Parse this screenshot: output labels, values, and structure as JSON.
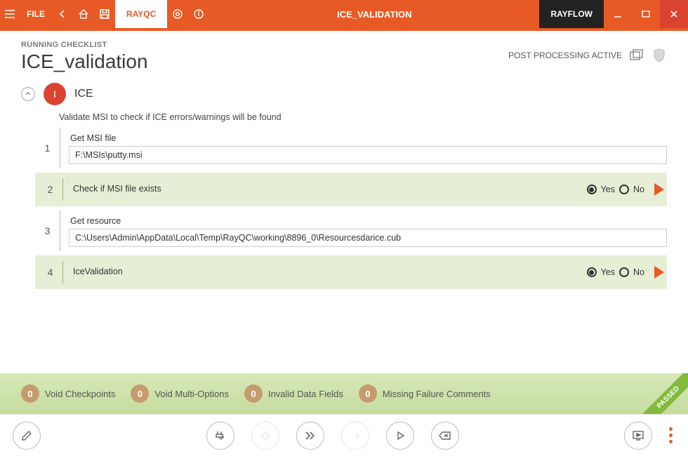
{
  "titlebar": {
    "file": "FILE",
    "tab_active": "RAYQC",
    "window_title": "ICE_VALIDATION",
    "rayflow": "RAYFLOW"
  },
  "header": {
    "running": "RUNNING CHECKLIST",
    "page_title": "ICE_validation",
    "post_processing": "POST PROCESSING ACTIVE"
  },
  "section": {
    "badge": "I",
    "title": "ICE",
    "description": "Validate MSI to check if ICE errors/warnings will be found"
  },
  "steps": [
    {
      "num": "1",
      "label": "Get MSI file",
      "value": "F:\\MSIs\\putty.msi",
      "type": "input"
    },
    {
      "num": "2",
      "label": "Check if MSI file exists",
      "type": "yn",
      "yes": "Yes",
      "no": "No",
      "selected": "yes"
    },
    {
      "num": "3",
      "label": "Get resource",
      "value": "C:\\Users\\Admin\\AppData\\Local\\Temp\\RayQC\\working\\8896_0\\Resourcesdarice.cub",
      "type": "input"
    },
    {
      "num": "4",
      "label": "IceValidation",
      "type": "yn",
      "yes": "Yes",
      "no": "No",
      "selected": "yes"
    }
  ],
  "summary": {
    "items": [
      {
        "count": "0",
        "label": "Void Checkpoints"
      },
      {
        "count": "0",
        "label": "Void Multi-Options"
      },
      {
        "count": "0",
        "label": "Invalid Data Fields"
      },
      {
        "count": "0",
        "label": "Missing Failure Comments"
      }
    ],
    "passed": "PASSED"
  }
}
